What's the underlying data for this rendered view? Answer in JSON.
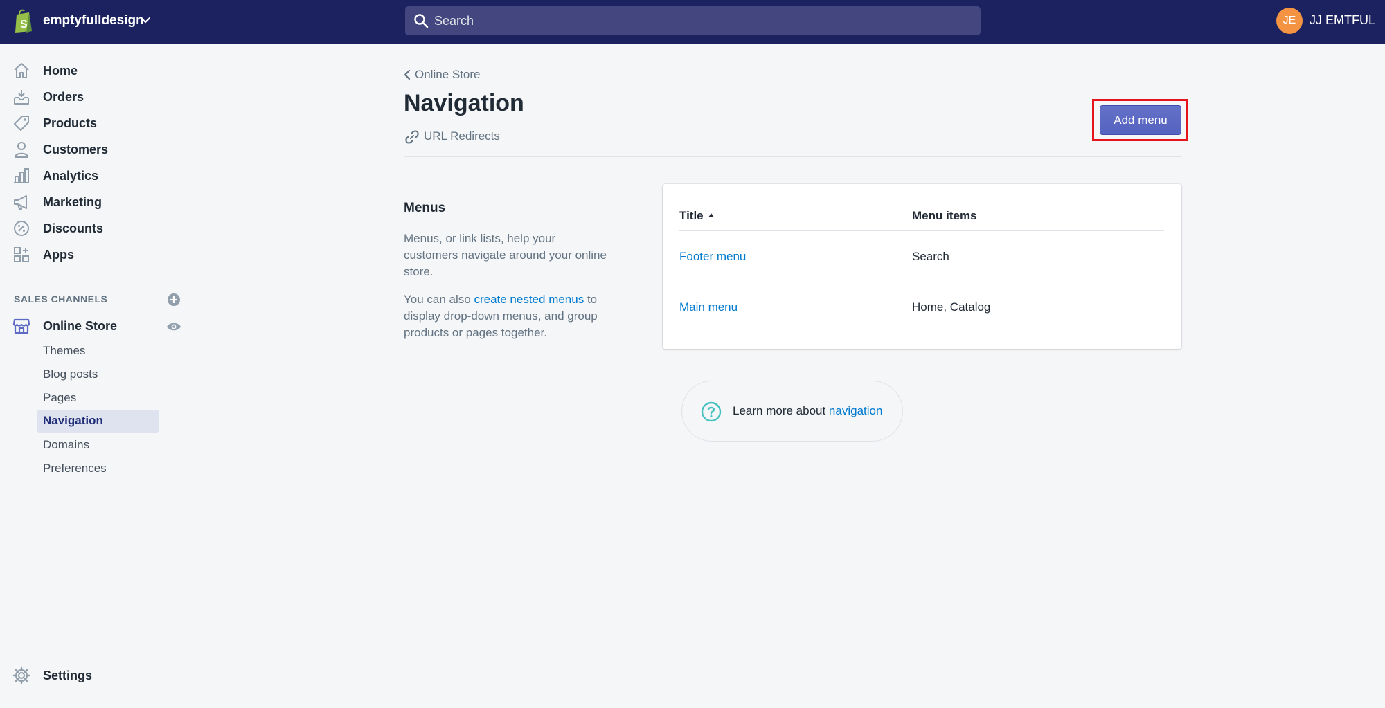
{
  "topbar": {
    "store_name": "emptyfulldesign",
    "search_placeholder": "Search",
    "avatar_initials": "JE",
    "user_name": "JJ EMTFUL"
  },
  "sidebar": {
    "items": [
      {
        "label": "Home",
        "icon": "home-icon"
      },
      {
        "label": "Orders",
        "icon": "orders-icon"
      },
      {
        "label": "Products",
        "icon": "tag-icon"
      },
      {
        "label": "Customers",
        "icon": "person-icon"
      },
      {
        "label": "Analytics",
        "icon": "bar-chart-icon"
      },
      {
        "label": "Marketing",
        "icon": "megaphone-icon"
      },
      {
        "label": "Discounts",
        "icon": "discount-icon"
      },
      {
        "label": "Apps",
        "icon": "apps-icon"
      }
    ],
    "sales_channels_heading": "SALES CHANNELS",
    "online_store_label": "Online Store",
    "sub_items": [
      "Themes",
      "Blog posts",
      "Pages",
      "Navigation",
      "Domains",
      "Preferences"
    ],
    "active_sub_item": "Navigation",
    "settings_label": "Settings"
  },
  "main": {
    "breadcrumb": "Online Store",
    "title": "Navigation",
    "url_redirects_label": "URL Redirects",
    "add_menu_label": "Add menu",
    "menus_heading": "Menus",
    "menus_description": "Menus, or link lists, help your customers navigate around your online store.",
    "nested_prefix": "You can also ",
    "nested_link": "create nested menus",
    "nested_suffix": " to display drop-down menus, and group products or pages together.",
    "table": {
      "col_title": "Title",
      "col_menu_items": "Menu items",
      "rows": [
        {
          "title": "Footer menu",
          "items": "Search"
        },
        {
          "title": "Main menu",
          "items": "Home, Catalog"
        }
      ]
    },
    "learn_more_prefix": "Learn more about ",
    "learn_more_link": "navigation"
  },
  "colors": {
    "topbar": "#1c2260",
    "accent_button": "#5c6ac4",
    "link": "#007ace",
    "highlight": "#e5141e",
    "avatar": "#f49342"
  }
}
